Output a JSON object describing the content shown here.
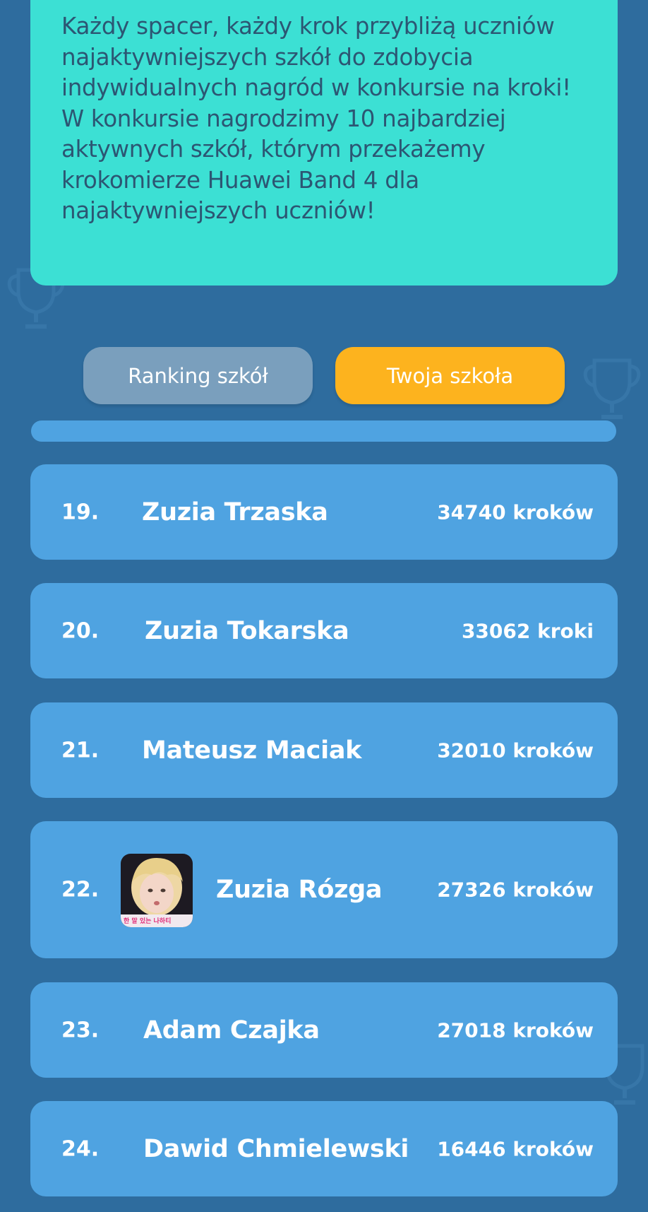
{
  "intro": {
    "text": "Każdy spacer, każdy krok przybliżą uczniów najaktywniejszych szkół do zdobycia indywidualnych nagród w konkursie na kroki! W konkursie nagrodzimy 10 najbardziej aktywnych szkół, którym przekażemy krokomierze Huawei Band 4 dla najaktywniejszych uczniów!"
  },
  "tabs": {
    "ranking_label": "Ranking szkół",
    "school_label": "Twoja szkoła"
  },
  "colors": {
    "background": "#2e6c9e",
    "intro_card": "#3ce0d4",
    "row": "#4fa3e1",
    "tab_inactive": "#7a9fbd",
    "tab_active": "#fdb31e"
  },
  "ranking": [
    {
      "rank": "19.",
      "name": "Zuzia Trzaska",
      "steps": "34740 kroków"
    },
    {
      "rank": "20.",
      "name": "Zuzia Tokarska",
      "steps": "33062 kroki"
    },
    {
      "rank": "21.",
      "name": "Mateusz Maciak",
      "steps": "32010 kroków"
    },
    {
      "rank": "22.",
      "name": "Zuzia Rózga",
      "steps": "27326 kroków",
      "avatar": "user-photo",
      "avatar_caption": "한 말 있는 나하티"
    },
    {
      "rank": "23.",
      "name": "Adam Czajka",
      "steps": "27018 kroków"
    },
    {
      "rank": "24.",
      "name": "Dawid Chmielewski",
      "steps": "16446 kroków"
    }
  ]
}
